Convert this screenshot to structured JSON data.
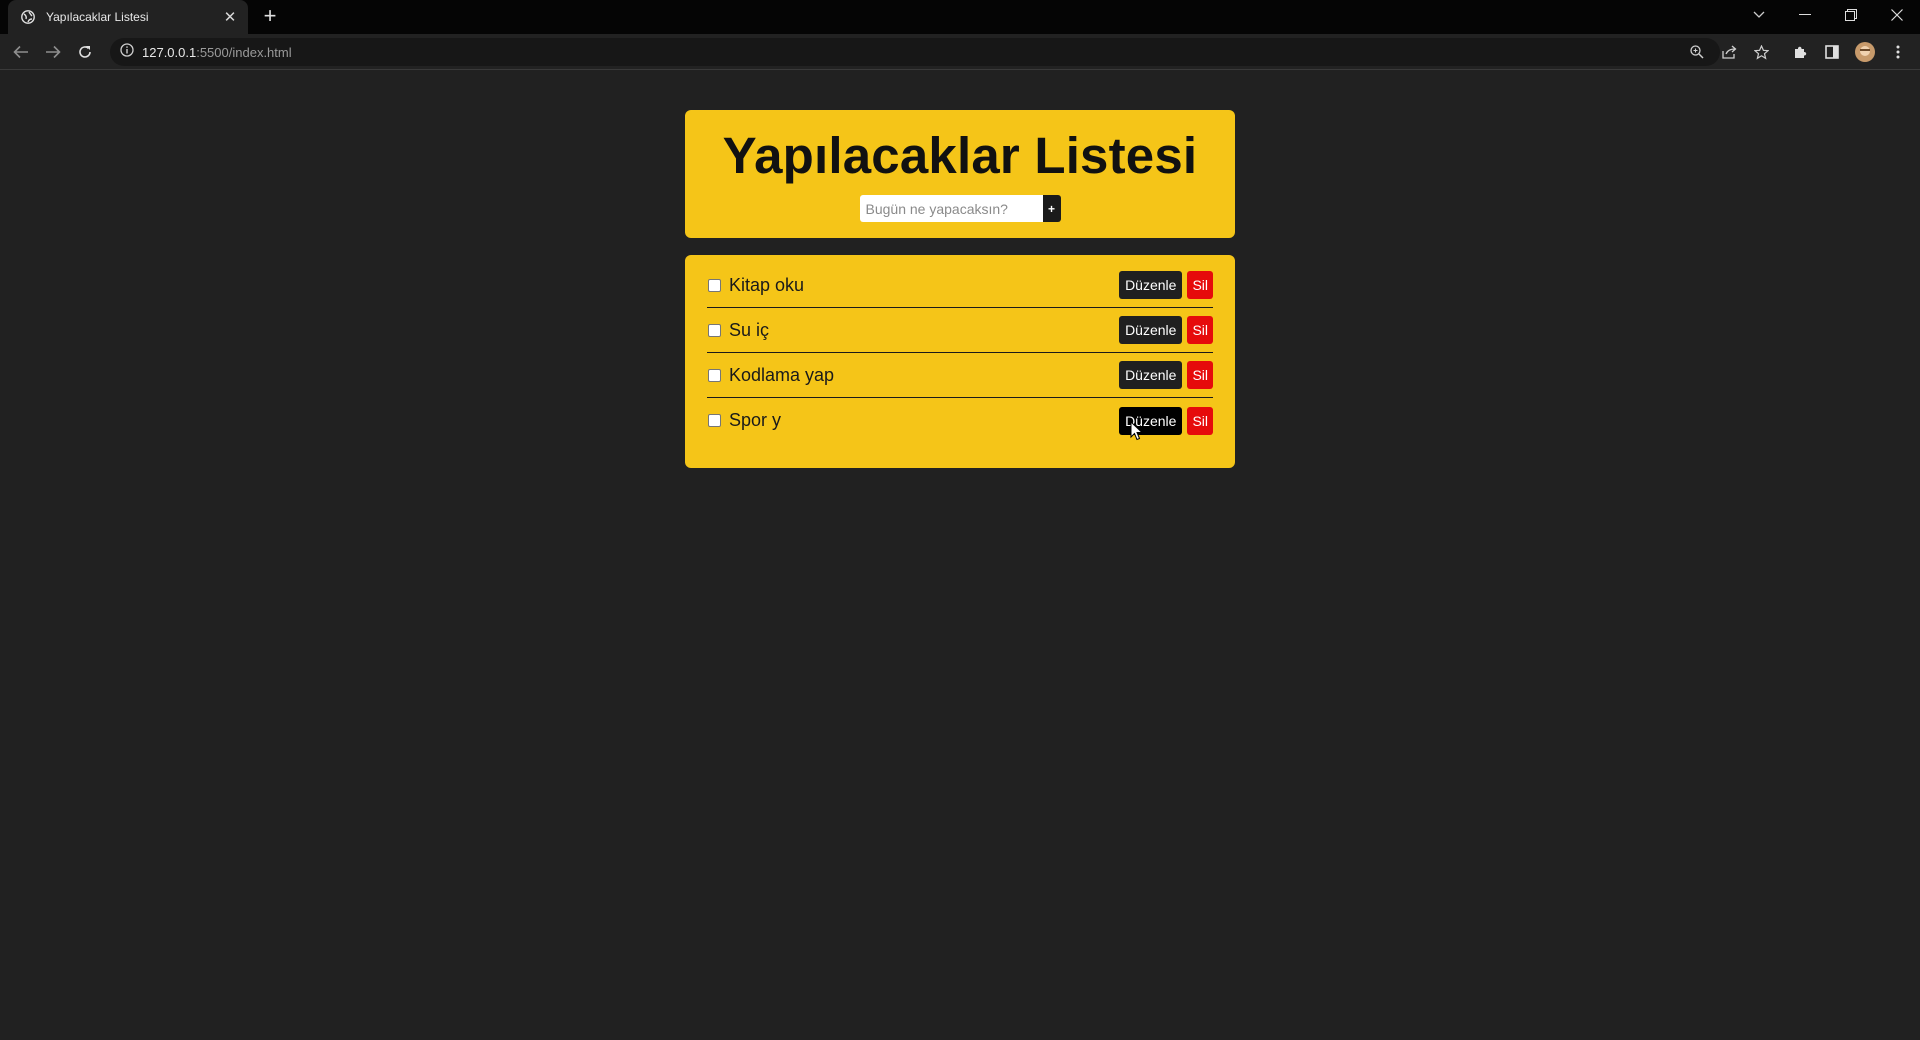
{
  "browser": {
    "tab_title": "Yapılacaklar Listesi",
    "url_host": "127.0.0.1",
    "url_rest": ":5500/index.html"
  },
  "page": {
    "title": "Yapılacaklar Listesi",
    "input_placeholder": "Bugün ne yapacaksın?",
    "add_button_label": "+"
  },
  "todos": [
    {
      "text": "Kitap oku",
      "edit_label": "Düzenle",
      "delete_label": "Sil"
    },
    {
      "text": "Su iç",
      "edit_label": "Düzenle",
      "delete_label": "Sil"
    },
    {
      "text": "Kodlama yap",
      "edit_label": "Düzenle",
      "delete_label": "Sil"
    },
    {
      "text": "Spor y",
      "edit_label": "Düzenle",
      "delete_label": "Sil"
    }
  ],
  "colors": {
    "background": "#212121",
    "card": "#f5c518",
    "edit_button": "#202020",
    "delete_button": "#e60b0b"
  }
}
